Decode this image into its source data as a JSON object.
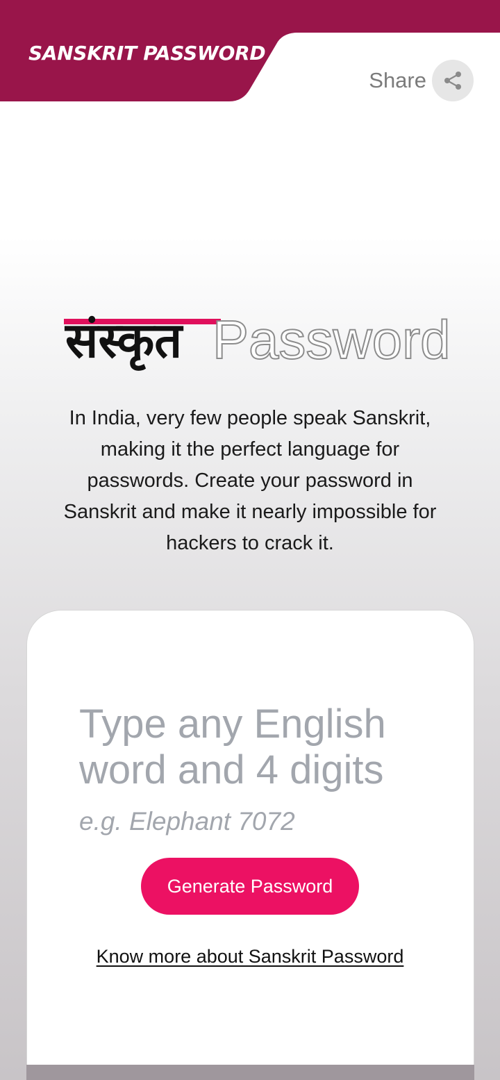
{
  "header": {
    "brand_title": "SANSKRIT PASSWORD",
    "share_label": "Share",
    "share_icon": "share-icon",
    "brand_color": "#99154a"
  },
  "logo": {
    "sanskrit_text": "संस्कृत",
    "password_text": "Password",
    "accent_color": "#e0105c"
  },
  "intro": {
    "text": "In India, very few people speak Sanskrit, making it the perfect language for passwords. Create your password in Sanskrit and make it nearly impossible for hackers to crack it."
  },
  "card": {
    "input_placeholder": "Type any English word and 4 digits",
    "input_value": "",
    "example_text": "e.g. Elephant 7072",
    "generate_button_label": "Generate Password",
    "button_color": "#ec1163",
    "know_more_link": "Know more about Sanskrit Password"
  }
}
